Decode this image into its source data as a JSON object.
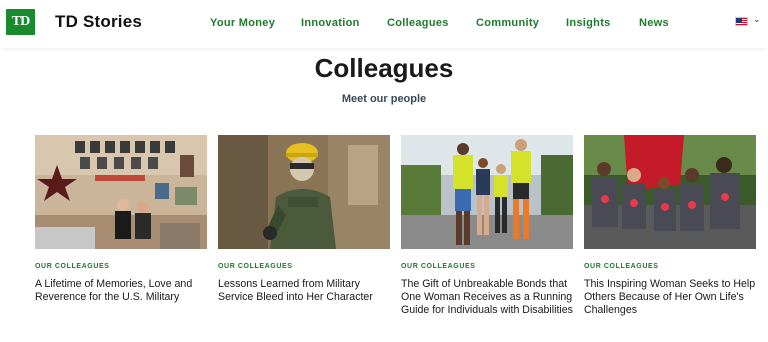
{
  "header": {
    "logo_text": "TD",
    "brand": "TD Stories",
    "nav": [
      "Your Money",
      "Innovation",
      "Colleagues",
      "Community",
      "Insights",
      "News"
    ],
    "caret": "⌄"
  },
  "colors": {
    "brand_green": "#1a8a2e",
    "nav_green": "#1f7a2c"
  },
  "page": {
    "title": "Colleagues",
    "subtitle": "Meet our people"
  },
  "cards": [
    {
      "tag": "OUR COLLEAGUES",
      "title": "A Lifetime of Memories, Love and Reverence for the U.S. Military"
    },
    {
      "tag": "OUR COLLEAGUES",
      "title": "Lessons Learned from Military Service Bleed into Her Character"
    },
    {
      "tag": "OUR COLLEAGUES",
      "title": "The Gift of Unbreakable Bonds that One Woman Receives as a Running Guide for Individuals with Disabilities"
    },
    {
      "tag": "OUR COLLEAGUES",
      "title": "This Inspiring Woman Seeks to Help Others Because of Her Own Life's Challenges"
    }
  ]
}
